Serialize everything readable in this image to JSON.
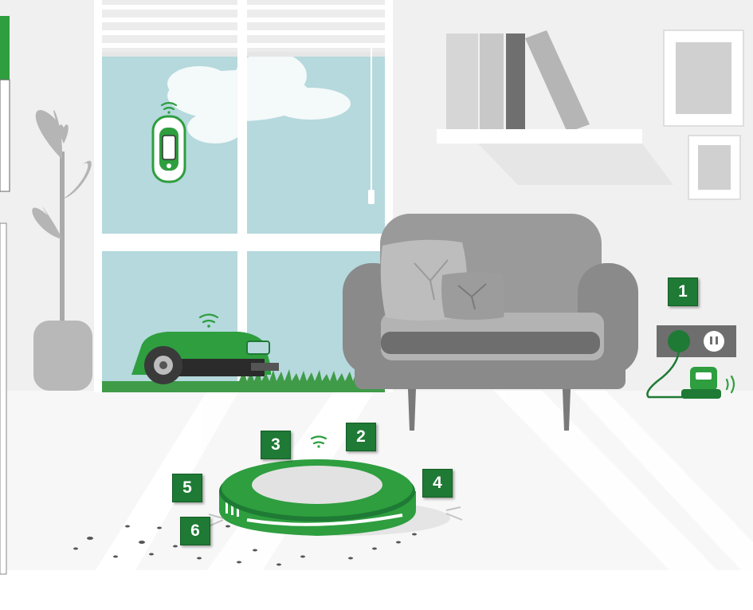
{
  "scene": {
    "colors": {
      "wall": "#f0f0f0",
      "floor": "#f7f7f7",
      "sky": "#b5d9dd",
      "grass": "#3f9b48",
      "brand_green": "#2e9e3f",
      "marker_green": "#1e7a34",
      "sofa": "#9a9a9a",
      "sofa_dark": "#6e6e6e"
    },
    "icons": {
      "robot_vacuum": "robot-vacuum-icon",
      "robot_mower": "robot-mower-icon",
      "phone": "smartphone-icon",
      "wifi": "wifi-icon",
      "charger": "charging-base-icon",
      "outlet": "power-outlet-icon"
    }
  },
  "markers": [
    {
      "id": "m1",
      "label": "1"
    },
    {
      "id": "m2",
      "label": "2"
    },
    {
      "id": "m3",
      "label": "3"
    },
    {
      "id": "m4",
      "label": "4"
    },
    {
      "id": "m5",
      "label": "5"
    },
    {
      "id": "m6",
      "label": "6"
    }
  ]
}
